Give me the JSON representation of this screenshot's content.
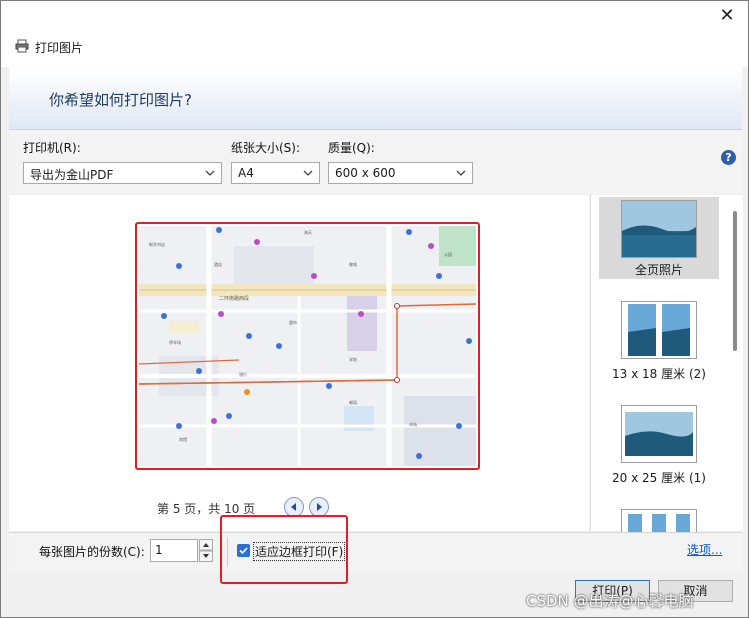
{
  "window": {
    "title": "打印图片",
    "close_glyph": "✕"
  },
  "banner": {
    "heading": "你希望如何打印图片?"
  },
  "options": {
    "printer_label": "打印机(R):",
    "printer_value": "导出为金山PDF",
    "paper_label": "纸张大小(S):",
    "paper_value": "A4",
    "quality_label": "质量(Q):",
    "quality_value": "600 x 600",
    "help_glyph": "?"
  },
  "preview": {
    "map_labels": {
      "road_main": "二环南路西段",
      "a1": "新华书店",
      "a2": "海天",
      "a3": "酒店",
      "a4": "咖啡",
      "a5": "公园",
      "a6": "停车场",
      "a7": "超市",
      "a8": "学校",
      "a9": "银行",
      "a10": "邮局",
      "a11": "市场",
      "a12": "宾馆"
    },
    "page_indicator": "第 5 页，共 10 页"
  },
  "layouts": [
    {
      "label": "全页照片",
      "selected": true
    },
    {
      "label": "13 x 18 厘米 (2)",
      "selected": false
    },
    {
      "label": "20 x 25 厘米 (1)",
      "selected": false
    }
  ],
  "bottom": {
    "copies_label": "每张图片的份数(C):",
    "copies_value": "1",
    "fit_label": "适应边框打印(F)",
    "fit_checked": true,
    "options_link": "选项..."
  },
  "footer": {
    "print_label": "打印(P)",
    "cancel_label": "取消"
  },
  "watermark": "CSDN @出涛@心馨电脑",
  "colors": {
    "highlight_red": "#e02020",
    "accent_blue": "#0a58c6",
    "selected_bg": "#d9d9d9"
  }
}
